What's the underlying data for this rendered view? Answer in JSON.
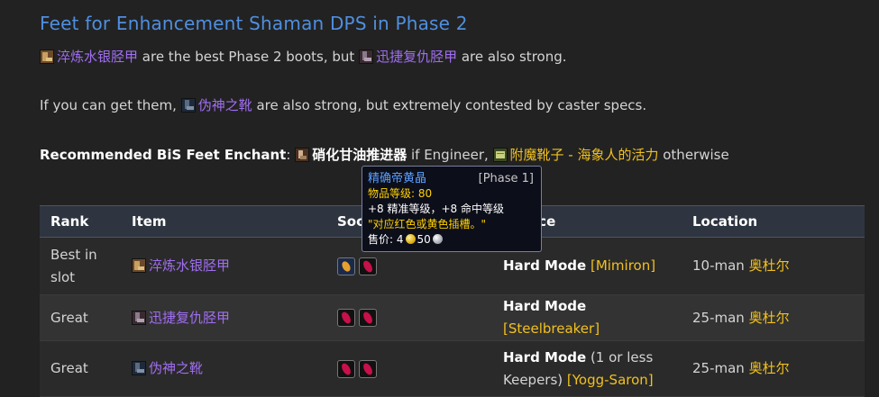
{
  "heading": "Feet for Enhancement Shaman DPS in Phase 2",
  "para1": {
    "item1": "淬炼水银胫甲",
    "mid": " are the best Phase 2 boots, but ",
    "item2": "迅捷复仇胫甲",
    "end": " are also strong."
  },
  "para2": {
    "start": "If you can get them, ",
    "item": "伪神之靴",
    "end": " are also strong, but extremely contested by caster specs."
  },
  "para3": {
    "label": "Recommended BiS Feet Enchant",
    "colon": ": ",
    "item1": "硝化甘油推进器",
    "mid": " if Engineer, ",
    "item2": "附魔靴子 - 海象人的活力",
    "end": " otherwise"
  },
  "table": {
    "headers": [
      "Rank",
      "Item",
      "Sockets",
      "Source",
      "Location"
    ],
    "rows": [
      {
        "rank": "Best in slot",
        "item": "淬炼水银胫甲",
        "source_bold": "Hard Mode",
        "source_pre": "",
        "source_link": "[Mimiron]",
        "loc_prefix": "10-man ",
        "loc_link": "奥杜尔"
      },
      {
        "rank": "Great",
        "item": "迅捷复仇胫甲",
        "source_bold": "Hard Mode",
        "source_pre": "",
        "source_link": "[Steelbreaker]",
        "loc_prefix": "25-man ",
        "loc_link": "奥杜尔"
      },
      {
        "rank": "Great",
        "item": "伪神之靴",
        "source_bold": "Hard Mode",
        "source_pre": " (1 or less Keepers) ",
        "source_link": "[Yogg-Saron]",
        "loc_prefix": "25-man ",
        "loc_link": "奥杜尔"
      }
    ]
  },
  "tooltip": {
    "title": "精确帝黄晶",
    "phase": "[Phase 1]",
    "ilvl": "物品等级: 80",
    "stats": "+8 精准等级，+8 命中等级",
    "note": "\"对应红色或黄色插槽。\"",
    "sell_label": "售价: ",
    "gold": "4",
    "silver": "50"
  },
  "colors": {
    "heading": "#4f8fe0",
    "epic": "#a06ef0",
    "gold_link": "#f2c01e",
    "header_bg": "#2e3440"
  }
}
